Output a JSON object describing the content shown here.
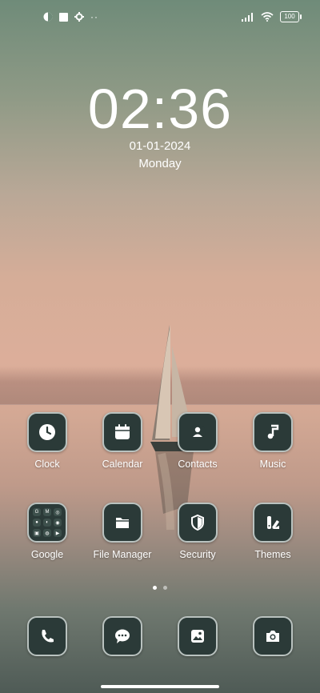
{
  "status_bar": {
    "battery": "100"
  },
  "lock": {
    "time": "02:36",
    "date": "01-01-2024",
    "weekday": "Monday"
  },
  "apps_row1": [
    {
      "label": "Clock",
      "icon": "clock-icon"
    },
    {
      "label": "Calendar",
      "icon": "calendar-icon"
    },
    {
      "label": "Contacts",
      "icon": "contacts-icon"
    },
    {
      "label": "Music",
      "icon": "music-note-icon"
    }
  ],
  "apps_row2": [
    {
      "label": "Google",
      "icon": "google-folder-icon"
    },
    {
      "label": "File Manager",
      "icon": "folder-icon"
    },
    {
      "label": "Security",
      "icon": "shield-icon"
    },
    {
      "label": "Themes",
      "icon": "themes-icon"
    }
  ],
  "dock": [
    {
      "icon": "phone-icon"
    },
    {
      "icon": "messages-icon"
    },
    {
      "icon": "gallery-icon"
    },
    {
      "icon": "camera-icon"
    }
  ],
  "page_indicator": {
    "pages": 2,
    "active": 1
  },
  "colors": {
    "tile_bg": "#2b3a38",
    "tile_border": "#b9c2bf"
  }
}
